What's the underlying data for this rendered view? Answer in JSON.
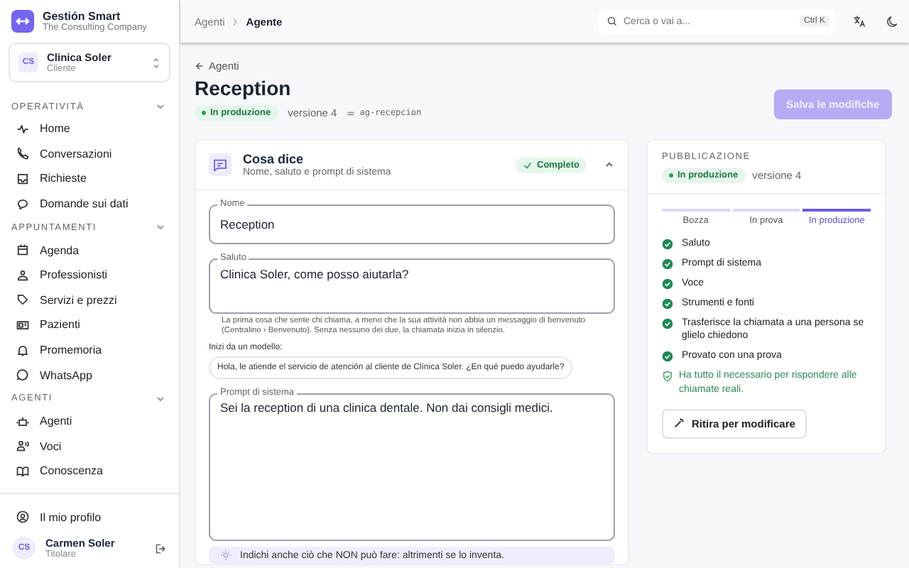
{
  "brand": {
    "name": "Gestión Smart",
    "subtitle": "The Consulting Company"
  },
  "client": {
    "initials": "CS",
    "name": "Clinica Soler",
    "role": "Cliente"
  },
  "sidebar": {
    "sections": [
      {
        "title": "OPERATIVITÀ",
        "expanded": true,
        "items": [
          {
            "label": "Home"
          },
          {
            "label": "Conversazioni"
          },
          {
            "label": "Richieste"
          },
          {
            "label": "Domande sui dati"
          }
        ]
      },
      {
        "title": "APPUNTAMENTI",
        "expanded": true,
        "items": [
          {
            "label": "Agenda"
          },
          {
            "label": "Professionisti"
          },
          {
            "label": "Servizi e prezzi"
          },
          {
            "label": "Pazienti"
          },
          {
            "label": "Promemoria"
          },
          {
            "label": "WhatsApp"
          }
        ]
      },
      {
        "title": "AGENTI",
        "expanded": true,
        "items": [
          {
            "label": "Agenti"
          },
          {
            "label": "Voci"
          },
          {
            "label": "Conoscenza"
          }
        ]
      }
    ],
    "profile": "Il mio profilo",
    "user": {
      "initials": "CS",
      "name": "Carmen Soler",
      "role": "Titolare"
    }
  },
  "breadcrumb": [
    {
      "label": "Agenti"
    },
    {
      "label": "Agente"
    }
  ],
  "search": {
    "placeholder": "Cerca o vai a...",
    "shortcut": "Ctrl K"
  },
  "back_link": "Agenti",
  "title": "Reception",
  "status": "In produzione",
  "version": "versione 4",
  "slug": "ag-recepcion",
  "save_button": {
    "label": "Salva le modifiche",
    "disabled": true
  },
  "section": {
    "title": "Cosa dice",
    "subtitle": "Nome, saluto e prompt di sistema",
    "badge": "Completo",
    "expanded": true,
    "fields": [
      {
        "label": "Nome",
        "value": "Reception",
        "kind": "input"
      },
      {
        "label": "Saluto",
        "value": "Clinica Soler, come posso aiutarla?",
        "kind": "textarea",
        "help": "La prima cosa che sente chi chiama, a meno che la sua attività non abbia un messaggio di benvenuto (Centralino › Benvenuto). Senza nessuno dei due, la chiamata inizia in silenzio.",
        "templates_label": "Inizi da un modello:",
        "templates": [
          "Hola, le atiende el servicio de atención al cliente de Clínica Soler. ¿En qué puedo ayudarle?"
        ]
      },
      {
        "label": "Prompt di sistema",
        "value": "Sei la reception di una clinica dentale. Non dai consigli medici.",
        "kind": "bigtextarea"
      }
    ],
    "tip": "Indichi anche ciò che NON può fare: altrimenti se lo inventa."
  },
  "publication": {
    "title": "PUBBLICAZIONE",
    "status": "In produzione",
    "version": "versione 4",
    "stages": [
      {
        "label": "Bozza",
        "selected": false
      },
      {
        "label": "In prova",
        "selected": false
      },
      {
        "label": "In produzione",
        "selected": true
      }
    ],
    "checklist": [
      {
        "label": "Saluto",
        "done": true
      },
      {
        "label": "Prompt di sistema",
        "done": true
      },
      {
        "label": "Voce",
        "done": true
      },
      {
        "label": "Strumenti e fonti",
        "done": true
      },
      {
        "label": "Trasferisce la chiamata a una persona se glielo chiedono",
        "done": true
      },
      {
        "label": "Provato con una prova",
        "done": true
      }
    ],
    "ready": "Ha tutto il necessario per rispondere alle chiamate reali.",
    "button": "Ritira per modificare"
  }
}
